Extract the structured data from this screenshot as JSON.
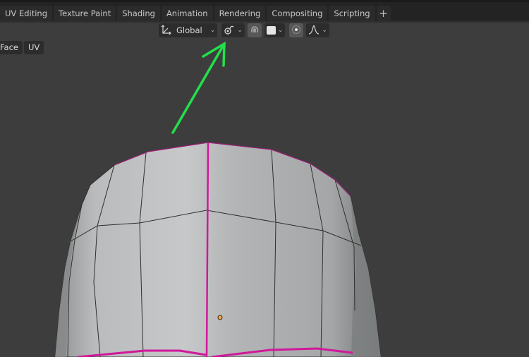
{
  "workspace_tabs": [
    {
      "label": "UV Editing"
    },
    {
      "label": "Texture Paint"
    },
    {
      "label": "Shading"
    },
    {
      "label": "Animation"
    },
    {
      "label": "Rendering"
    },
    {
      "label": "Compositing"
    },
    {
      "label": "Scripting"
    }
  ],
  "add_workspace_label": "+",
  "header_tools": {
    "orientation": {
      "icon": "transform-orientation-icon",
      "value": "Global"
    },
    "pivot": {
      "icon": "pivot-point-icon"
    },
    "snap": {
      "icon": "snap-magnet-icon",
      "active": true
    },
    "snap_target": {
      "icon": "snap-increment-square-icon"
    },
    "proportional_edit": {
      "icon": "proportional-editing-icon",
      "active": true
    },
    "falloff": {
      "icon": "falloff-smooth-curve-icon"
    }
  },
  "mode_buttons": [
    {
      "label": "Face"
    },
    {
      "label": "UV"
    }
  ],
  "annotation": {
    "type": "arrow",
    "color": "#22e04a",
    "points_to": "pivot-point-dropdown"
  },
  "colors": {
    "seam_edge": "#d0189a",
    "origin_dot": "#f5a64a",
    "viewport_bg": "#3d3d3d",
    "topbar_bg": "#232323",
    "mesh_fill": "#bdbfc0"
  }
}
